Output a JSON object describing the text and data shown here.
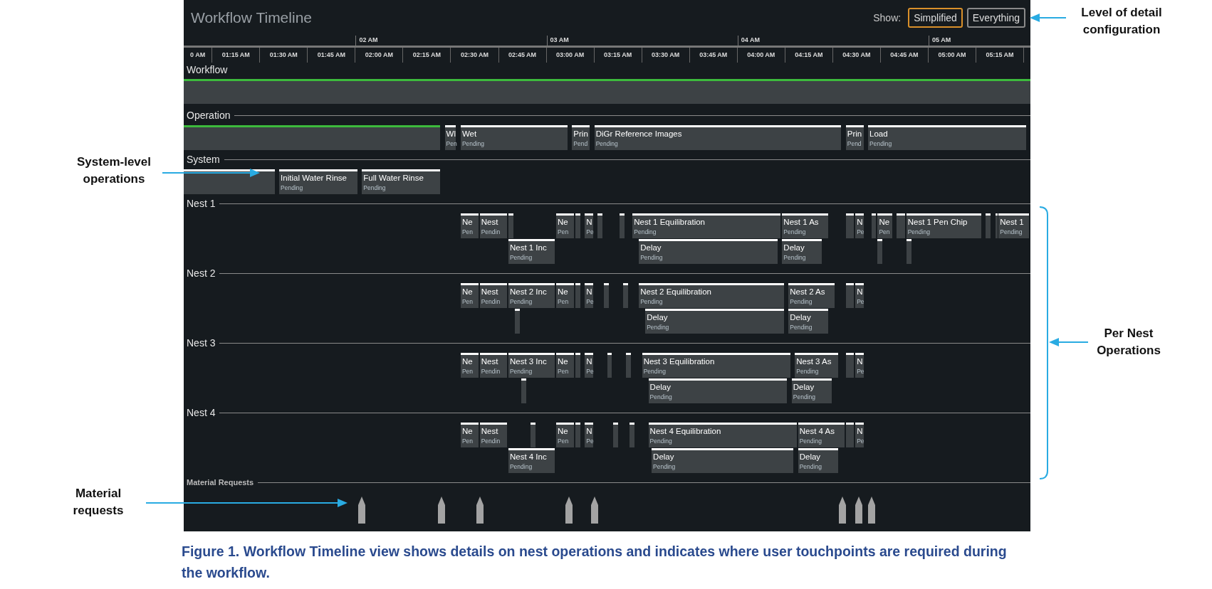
{
  "window": {
    "title": "Workflow Timeline"
  },
  "show": {
    "label": "Show:",
    "options": [
      {
        "label": "Simplified",
        "selected": true
      },
      {
        "label": "Everything",
        "selected": false
      }
    ]
  },
  "axis": {
    "hours": [
      "02 AM",
      "03 AM",
      "04 AM",
      "05 AM"
    ],
    "quarters": [
      "0 AM",
      "01:15 AM",
      "01:30 AM",
      "01:45 AM",
      "02:00 AM",
      "02:15 AM",
      "02:30 AM",
      "02:45 AM",
      "03:00 AM",
      "03:15 AM",
      "03:30 AM",
      "03:45 AM",
      "04:00 AM",
      "04:15 AM",
      "04:30 AM",
      "04:45 AM",
      "05:00 AM",
      "05:15 AM"
    ]
  },
  "sections": [
    {
      "label": "Workflow",
      "kind": "band",
      "complete": true
    },
    {
      "label": "Operation",
      "kind": "track",
      "lanes": [
        {
          "blocks": [
            {
              "complete": true
            },
            {
              "title": "Wl",
              "status": "Pen",
              "complete": false
            },
            {
              "title": "Wet",
              "status": "Pending",
              "complete": false
            },
            {
              "title": "Prin",
              "status": "Pend",
              "complete": false
            },
            {
              "title": "DiGr Reference Images",
              "status": "Pending",
              "complete": false
            },
            {
              "title": "Prin",
              "status": "Pend",
              "complete": false
            },
            {
              "title": "Load",
              "status": "Pending",
              "complete": false
            }
          ]
        }
      ]
    },
    {
      "label": "System",
      "kind": "track",
      "lanes": [
        {
          "blocks": [
            {
              "complete": false
            },
            {
              "title": "Initial Water Rinse",
              "status": "Pending",
              "complete": false
            },
            {
              "title": "Full Water Rinse",
              "status": "Pending",
              "complete": false
            }
          ]
        }
      ]
    },
    {
      "label": "Nest 1",
      "kind": "track",
      "lanes": [
        {
          "blocks": [
            {
              "title": "Ne",
              "status": "Pen",
              "complete": false
            },
            {
              "title": "Nest",
              "status": "Pendin",
              "complete": false
            },
            {
              "complete": false
            },
            {
              "title": "Ne",
              "status": "Pen",
              "complete": false
            },
            {
              "complete": false
            },
            {
              "title": "N",
              "status": "Pe",
              "complete": false
            },
            {
              "complete": false
            },
            {
              "complete": false
            },
            {
              "title": "Nest 1 Equilibration",
              "status": "Pending",
              "complete": false
            },
            {
              "title": "Nest 1 As",
              "status": "Pending",
              "complete": false
            },
            {
              "complete": false
            },
            {
              "title": "N",
              "status": "Pe",
              "complete": false
            },
            {
              "complete": false
            },
            {
              "title": "Ne",
              "status": "Pen",
              "complete": false
            },
            {
              "complete": false
            },
            {
              "title": "Nest 1 Pen Chip",
              "status": "Pending",
              "complete": false
            },
            {
              "complete": false
            },
            {
              "complete": false
            },
            {
              "title": "Nest 1",
              "status": "Pending",
              "complete": false
            }
          ]
        },
        {
          "blocks": [
            {
              "title": "Nest 1 Inc",
              "status": "Pending",
              "complete": false
            },
            {
              "title": "Delay",
              "status": "Pending",
              "complete": false
            },
            {
              "title": "Delay",
              "status": "Pending",
              "complete": false
            },
            {
              "complete": false
            },
            {
              "complete": false
            }
          ]
        }
      ]
    },
    {
      "label": "Nest 2",
      "kind": "track",
      "lanes": [
        {
          "blocks": [
            {
              "title": "Ne",
              "status": "Pen",
              "complete": false
            },
            {
              "title": "Nest",
              "status": "Pendin",
              "complete": false
            },
            {
              "title": "Nest 2 Inc",
              "status": "Pending",
              "complete": false
            },
            {
              "title": "Ne",
              "status": "Pen",
              "complete": false
            },
            {
              "complete": false
            },
            {
              "title": "N",
              "status": "Pe",
              "complete": false
            },
            {
              "complete": false
            },
            {
              "complete": false
            },
            {
              "title": "Nest 2 Equilibration",
              "status": "Pending",
              "complete": false
            },
            {
              "title": "Nest 2 As",
              "status": "Pending",
              "complete": false
            },
            {
              "complete": false
            },
            {
              "title": "N",
              "status": "Pe",
              "complete": false
            }
          ]
        },
        {
          "blocks": [
            {
              "complete": false
            },
            {
              "title": "Delay",
              "status": "Pending",
              "complete": false
            },
            {
              "title": "Delay",
              "status": "Pending",
              "complete": false
            }
          ]
        }
      ]
    },
    {
      "label": "Nest 3",
      "kind": "track",
      "lanes": [
        {
          "blocks": [
            {
              "title": "Ne",
              "status": "Pen",
              "complete": false
            },
            {
              "title": "Nest",
              "status": "Pendin",
              "complete": false
            },
            {
              "title": "Nest 3 Inc",
              "status": "Pending",
              "complete": false
            },
            {
              "title": "Ne",
              "status": "Pen",
              "complete": false
            },
            {
              "complete": false
            },
            {
              "title": "N",
              "status": "Pe",
              "complete": false
            },
            {
              "complete": false
            },
            {
              "complete": false
            },
            {
              "title": "Nest 3 Equilibration",
              "status": "Pending",
              "complete": false
            },
            {
              "title": "Nest 3 As",
              "status": "Pending",
              "complete": false
            },
            {
              "complete": false
            },
            {
              "title": "N",
              "status": "Pe",
              "complete": false
            }
          ]
        },
        {
          "blocks": [
            {
              "complete": false
            },
            {
              "title": "Delay",
              "status": "Pending",
              "complete": false
            },
            {
              "title": "Delay",
              "status": "Pending",
              "complete": false
            }
          ]
        }
      ]
    },
    {
      "label": "Nest 4",
      "kind": "track",
      "lanes": [
        {
          "blocks": [
            {
              "title": "Ne",
              "status": "Pen",
              "complete": false
            },
            {
              "title": "Nest",
              "status": "Pendin",
              "complete": false
            },
            {
              "complete": false
            },
            {
              "title": "Ne",
              "status": "Pen",
              "complete": false
            },
            {
              "complete": false
            },
            {
              "title": "N",
              "status": "Pe",
              "complete": false
            },
            {
              "complete": false
            },
            {
              "complete": false
            },
            {
              "title": "Nest 4 Equilibration",
              "status": "Pending",
              "complete": false
            },
            {
              "title": "Nest 4 As",
              "status": "Pending",
              "complete": false
            },
            {
              "complete": false
            },
            {
              "title": "N",
              "status": "Pe",
              "complete": false
            }
          ]
        },
        {
          "blocks": [
            {
              "title": "Nest 4 Inc",
              "status": "Pending",
              "complete": false
            },
            {
              "title": "Delay",
              "status": "Pending",
              "complete": false
            },
            {
              "title": "Delay",
              "status": "Pending",
              "complete": false
            }
          ]
        }
      ]
    },
    {
      "label": "Material Requests",
      "kind": "markers"
    }
  ],
  "annotations": [
    {
      "text": "Level of detail configuration",
      "kind": "arrow"
    },
    {
      "text": "System-level operations",
      "kind": "arrow"
    },
    {
      "text": "Per Nest Operations",
      "kind": "bracket"
    },
    {
      "text": "Material requests",
      "kind": "arrow"
    }
  ],
  "caption": "Figure 1. Workflow Timeline view shows details on nest operations and indicates where user touchpoints are required during the workflow."
}
